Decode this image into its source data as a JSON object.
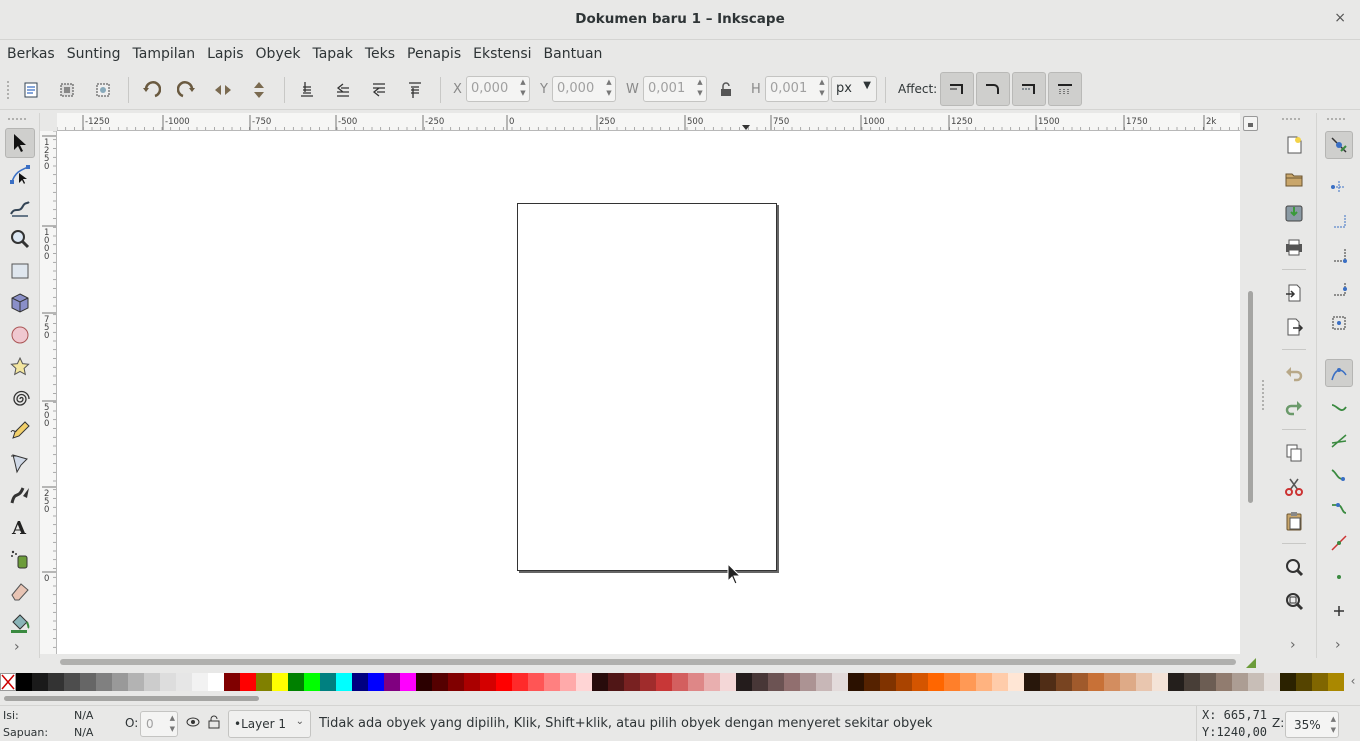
{
  "window": {
    "title": "Dokumen baru 1 – Inkscape",
    "close_glyph": "×"
  },
  "menubar": [
    "Berkas",
    "Sunting",
    "Tampilan",
    "Lapis",
    "Obyek",
    "Tapak",
    "Teks",
    "Penapis",
    "Ekstensi",
    "Bantuan"
  ],
  "toolbar": {
    "x": {
      "label": "X",
      "value": "0,000"
    },
    "y": {
      "label": "Y",
      "value": "0,000"
    },
    "w": {
      "label": "W",
      "value": "0,001"
    },
    "h": {
      "label": "H",
      "value": "0,001"
    },
    "unit": "px",
    "affect_label": "Affect:"
  },
  "ruler": {
    "h_ticks": [
      "-1250",
      "-1000",
      "-750",
      "-500",
      "-250",
      "0",
      "250",
      "500",
      "750",
      "1000",
      "1250",
      "1500",
      "1750",
      "2k"
    ],
    "v_ticks": [
      "1\n2\n5\n0",
      "1\n0\n0\n0",
      "7\n5\n0",
      "5\n0\n0",
      "2\n5\n0",
      "0"
    ]
  },
  "palette": [
    "#000000",
    "#1a1a1a",
    "#333333",
    "#4d4d4d",
    "#666666",
    "#808080",
    "#999999",
    "#b3b3b3",
    "#cccccc",
    "#dddddd",
    "#e6e6e6",
    "#f2f2f2",
    "#ffffff",
    "#800000",
    "#ff0000",
    "#808000",
    "#ffff00",
    "#008000",
    "#00ff00",
    "#008080",
    "#00ffff",
    "#000080",
    "#0000ff",
    "#800080",
    "#ff00ff",
    "#2b0000",
    "#550000",
    "#800000",
    "#aa0000",
    "#d40000",
    "#ff0000",
    "#ff2a2a",
    "#ff5555",
    "#ff8080",
    "#ffaaaa",
    "#ffd5d5",
    "#280b0b",
    "#501616",
    "#782121",
    "#a02c2c",
    "#c83737",
    "#d35f5f",
    "#de8787",
    "#e9afaf",
    "#f4d7d7",
    "#241c1c",
    "#483737",
    "#6c5353",
    "#916f6f",
    "#ac9393",
    "#c8b7b7",
    "#e3dbdb",
    "#2b1100",
    "#552200",
    "#803300",
    "#aa4400",
    "#d45500",
    "#ff6600",
    "#ff7f2a",
    "#ff9955",
    "#ffb380",
    "#ffccaa",
    "#ffe6d5",
    "#28170b",
    "#502d16",
    "#784421",
    "#a05a2c",
    "#c87137",
    "#d38d5f",
    "#deaa87",
    "#e9c6af",
    "#f4e3d7",
    "#241f1c",
    "#483e37",
    "#6c5d53",
    "#917c6f",
    "#ac9d93",
    "#c8beb7",
    "#e3dedb",
    "#2b2200",
    "#554400",
    "#806600",
    "#aa8800"
  ],
  "status": {
    "fill_label": "Isi:",
    "fill_value": "N/A",
    "stroke_label": "Sapuan:",
    "stroke_value": "N/A",
    "opacity_label": "O:",
    "opacity_value": "0",
    "layer": "•Layer 1",
    "message": "Tidak ada obyek yang dipilih, Klik, Shift+klik, atau pilih obyek dengan menyeret sekitar obyek",
    "x_coord": "X:  665,71",
    "y_coord": "Y:1240,00",
    "zoom_label": "Z:",
    "zoom": "35%"
  },
  "icons": {
    "accent": "#2a5db0"
  }
}
